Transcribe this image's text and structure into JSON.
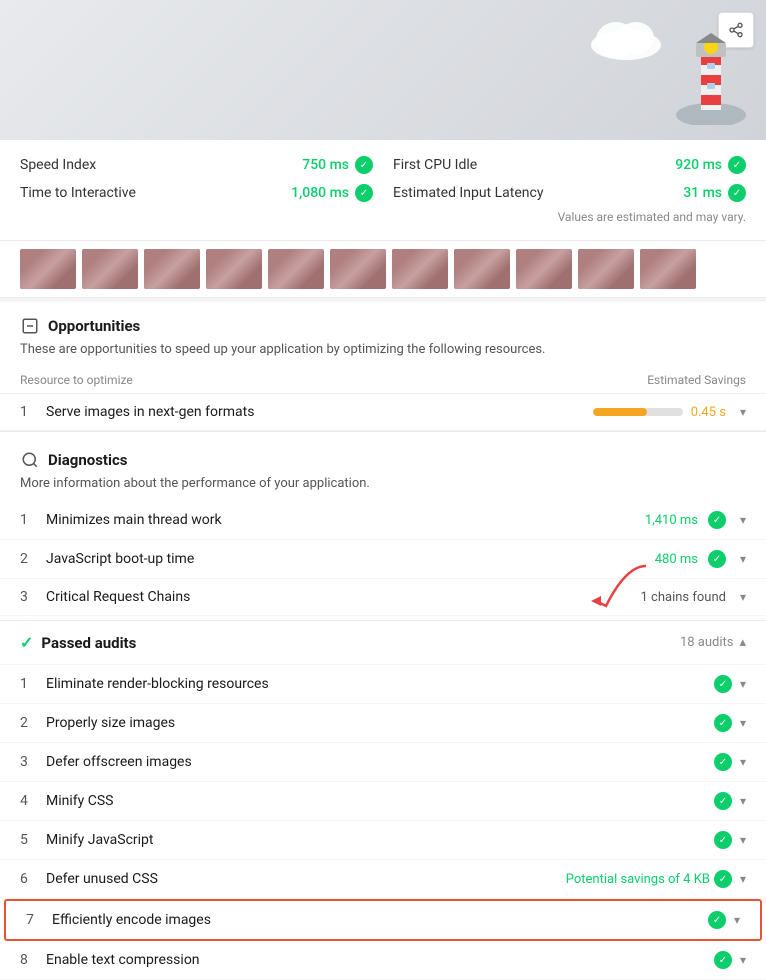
{
  "header": {
    "share_label": "⬆"
  },
  "metrics": {
    "speed_index_label": "Speed Index",
    "speed_index_value": "750 ms",
    "first_cpu_idle_label": "First CPU Idle",
    "first_cpu_idle_value": "920 ms",
    "time_to_interactive_label": "Time to Interactive",
    "time_to_interactive_value": "1,080 ms",
    "estimated_input_latency_label": "Estimated Input Latency",
    "estimated_input_latency_value": "31 ms",
    "note": "Values are estimated and may vary."
  },
  "opportunities": {
    "section_title": "Opportunities",
    "section_desc": "These are opportunities to speed up your application by optimizing the following resources.",
    "col_resource": "Resource to optimize",
    "col_savings": "Estimated Savings",
    "items": [
      {
        "num": "1",
        "label": "Serve images in next-gen formats",
        "savings_value": "0.45 s",
        "bar_pct": 60
      }
    ]
  },
  "diagnostics": {
    "section_title": "Diagnostics",
    "section_desc": "More information about the performance of your application.",
    "items": [
      {
        "num": "1",
        "label": "Minimizes main thread work",
        "value": "1,410 ms",
        "type": "green"
      },
      {
        "num": "2",
        "label": "JavaScript boot-up time",
        "value": "480 ms",
        "type": "green"
      },
      {
        "num": "3",
        "label": "Critical Request Chains",
        "value": "1 chains found",
        "type": "neutral"
      }
    ]
  },
  "passed_audits": {
    "section_title": "Passed audits",
    "count": "18 audits",
    "items": [
      {
        "num": "1",
        "label": "Eliminate render-blocking resources",
        "highlighted": false
      },
      {
        "num": "2",
        "label": "Properly size images",
        "highlighted": false
      },
      {
        "num": "3",
        "label": "Defer offscreen images",
        "highlighted": false
      },
      {
        "num": "4",
        "label": "Minify CSS",
        "highlighted": false
      },
      {
        "num": "5",
        "label": "Minify JavaScript",
        "highlighted": false
      },
      {
        "num": "6",
        "label": "Defer unused CSS",
        "savings": "Potential savings of 4 KB",
        "highlighted": false
      },
      {
        "num": "7",
        "label": "Efficiently encode images",
        "highlighted": true
      },
      {
        "num": "8",
        "label": "Enable text compression",
        "highlighted": false
      }
    ]
  }
}
